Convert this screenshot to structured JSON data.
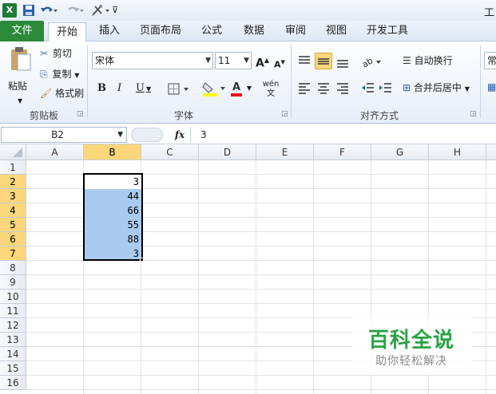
{
  "title_fragment": "工",
  "tabs": [
    "文件",
    "开始",
    "插入",
    "页面布局",
    "公式",
    "数据",
    "审阅",
    "视图",
    "开发工具"
  ],
  "active_tab": "开始",
  "clipboard": {
    "paste": "粘贴",
    "cut": "剪切",
    "copy": "复制",
    "format_painter": "格式刷",
    "label": "剪贴板"
  },
  "font": {
    "name": "宋体",
    "size": "11",
    "label": "字体",
    "bold": "B",
    "italic": "I",
    "underline": "U",
    "grow": "A",
    "shrink": "A",
    "font_color": "A",
    "wen": "wén文"
  },
  "alignment": {
    "wrap": "自动换行",
    "merge": "合并后居中",
    "label": "对齐方式"
  },
  "number_fragment": "常",
  "formula_bar": {
    "name_box": "B2",
    "fx": "fx",
    "value": "3"
  },
  "columns": [
    "A",
    "B",
    "C",
    "D",
    "E",
    "F",
    "G",
    "H"
  ],
  "selected_column": "B",
  "rows": [
    "1",
    "2",
    "3",
    "4",
    "5",
    "6",
    "7",
    "8",
    "9",
    "10",
    "11",
    "12",
    "13",
    "14",
    "15",
    "16"
  ],
  "selected_rows": [
    "2",
    "3",
    "4",
    "5",
    "6",
    "7"
  ],
  "cells": [
    {
      "ref": "B2",
      "value": "3"
    },
    {
      "ref": "B3",
      "value": "44"
    },
    {
      "ref": "B4",
      "value": "66"
    },
    {
      "ref": "B5",
      "value": "55"
    },
    {
      "ref": "B6",
      "value": "88"
    },
    {
      "ref": "B7",
      "value": "3"
    }
  ],
  "watermark": {
    "title": "百科全说",
    "subtitle": "助你轻松解决"
  },
  "colors": {
    "file_tab": "#2a8a3a",
    "selection": "#aacbef",
    "header_selected": "#fbd67a",
    "watermark": "#2ba245"
  }
}
